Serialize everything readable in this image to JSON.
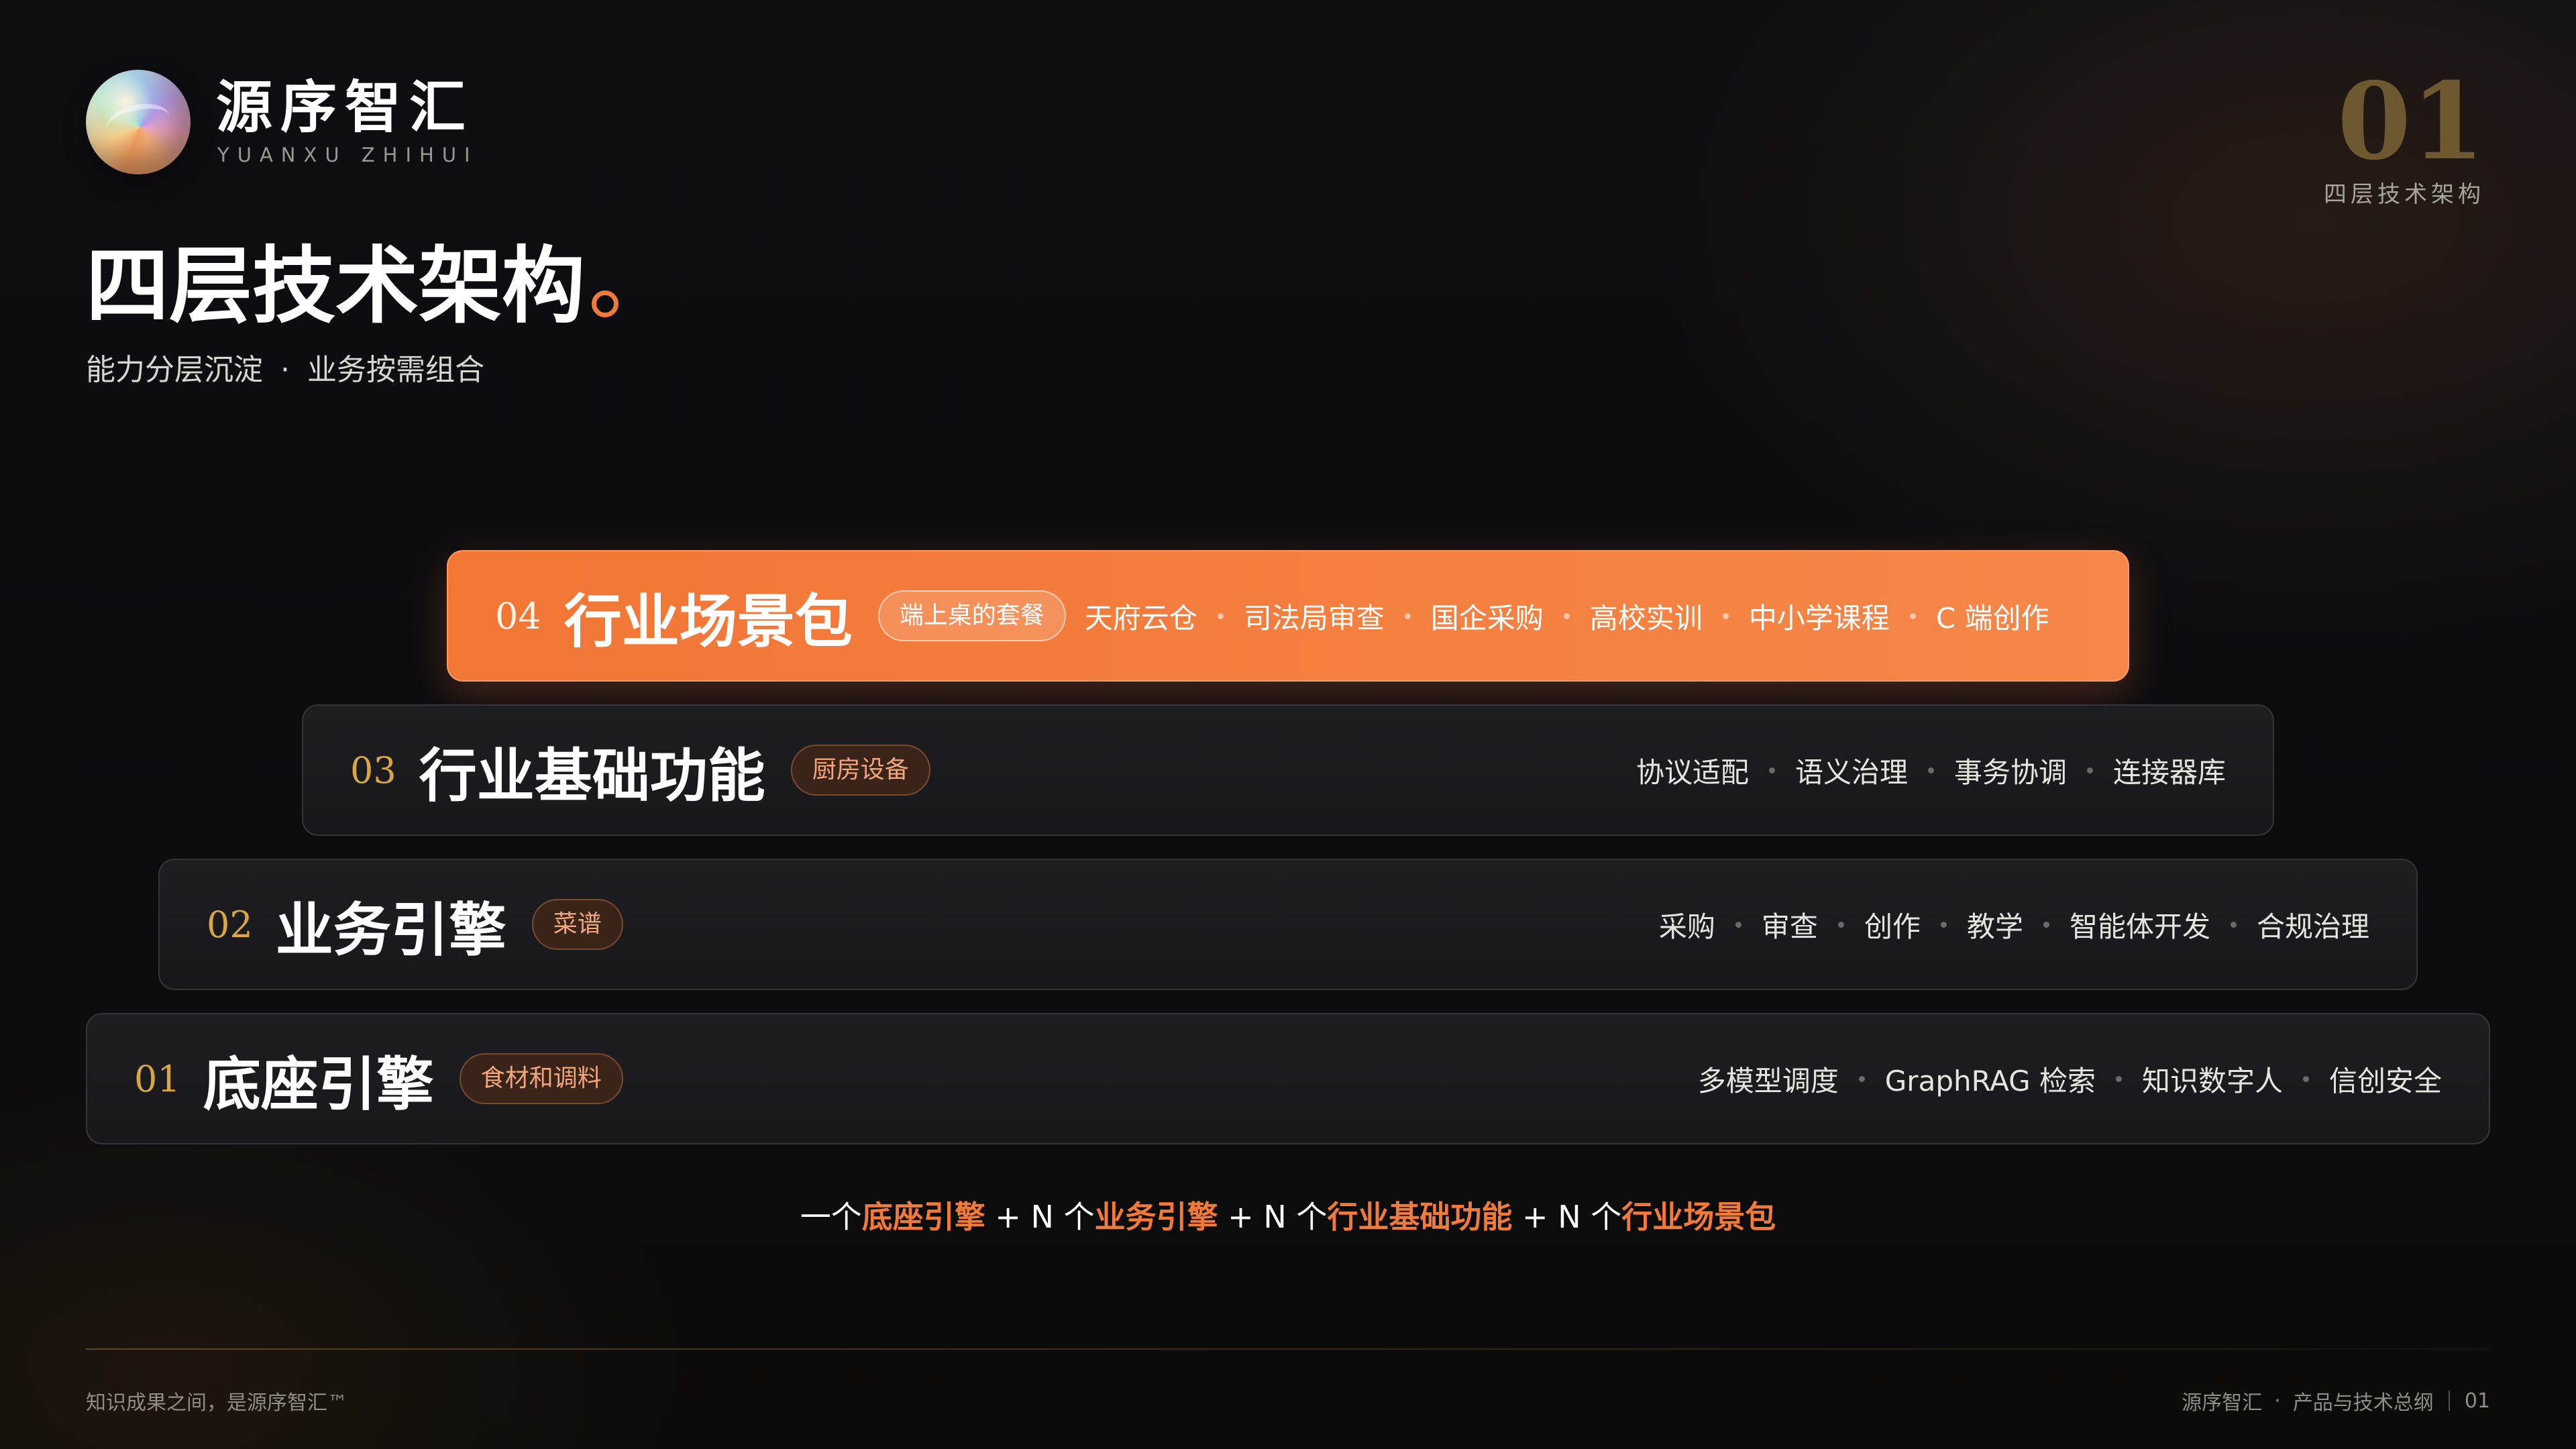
{
  "brand": {
    "name_cn": "源序智汇",
    "name_en": "YUANXU ZHIHUI",
    "logo_icon": "gradient-orb-logo"
  },
  "page": {
    "number": "01",
    "section": "四层技术架构"
  },
  "title": "四层技术架构",
  "subtitle": {
    "left": "能力分层沉淀",
    "sep": "·",
    "right": "业务按需组合"
  },
  "layers": [
    {
      "num": "04",
      "name": "行业场景包",
      "tag": "端上桌的套餐",
      "items": [
        "天府云仓",
        "司法局审查",
        "国企采购",
        "高校实训",
        "中小学课程",
        "C 端创作"
      ],
      "highlight": true
    },
    {
      "num": "03",
      "name": "行业基础功能",
      "tag": "厨房设备",
      "items": [
        "协议适配",
        "语义治理",
        "事务协调",
        "连接器库"
      ]
    },
    {
      "num": "02",
      "name": "业务引擎",
      "tag": "菜谱",
      "items": [
        "采购",
        "审查",
        "创作",
        "教学",
        "智能体开发",
        "合规治理"
      ]
    },
    {
      "num": "01",
      "name": "底座引擎",
      "tag": "食材和调料",
      "items": [
        "多模型调度",
        "GraphRAG 检索",
        "知识数字人",
        "信创安全"
      ]
    }
  ],
  "formula": {
    "p1": "一个",
    "h1": "底座引擎",
    "p2": " + N 个",
    "h2": "业务引擎",
    "p3": " + N 个",
    "h3": "行业基础功能",
    "p4": " + N 个",
    "h4": "行业场景包"
  },
  "footer": {
    "left": "知识成果之间，是源序智汇™",
    "right_brand": "源序智汇",
    "right_sep": "·",
    "right_doc": "产品与技术总纲",
    "right_page": "01"
  },
  "colors": {
    "accent": "#f27636",
    "gold": "#d9a640",
    "background": "#0e0e12"
  }
}
